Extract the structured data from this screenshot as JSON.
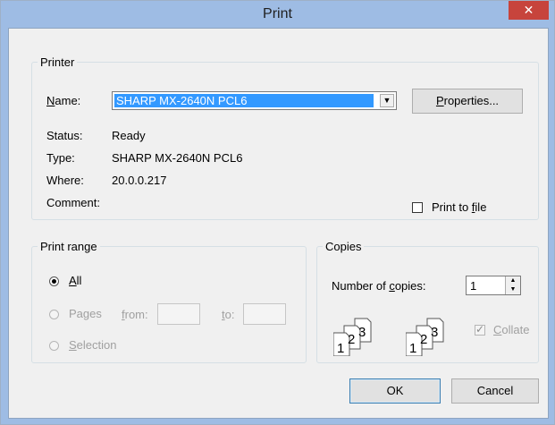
{
  "window": {
    "title": "Print",
    "close_glyph": "✕"
  },
  "printer": {
    "legend": "Printer",
    "name_label": "Name:",
    "name_value": "SHARP MX-2640N PCL6",
    "properties_button": "Properties...",
    "status_label": "Status:",
    "status_value": "Ready",
    "type_label": "Type:",
    "type_value": "SHARP MX-2640N PCL6",
    "where_label": "Where:",
    "where_value": "20.0.0.217",
    "comment_label": "Comment:",
    "comment_value": "",
    "print_to_file_label": "Print to file",
    "print_to_file_checked": false
  },
  "print_range": {
    "legend": "Print range",
    "all_label": "All",
    "pages_label": "Pages",
    "from_label": "from:",
    "to_label": "to:",
    "selection_label": "Selection",
    "selected": "All"
  },
  "copies": {
    "legend": "Copies",
    "number_label": "Number of copies:",
    "number_value": "1",
    "collate_label": "Collate",
    "collate_checked": true,
    "collate_icon_digits": [
      "1",
      "2",
      "3"
    ]
  },
  "buttons": {
    "ok": "OK",
    "cancel": "Cancel"
  }
}
